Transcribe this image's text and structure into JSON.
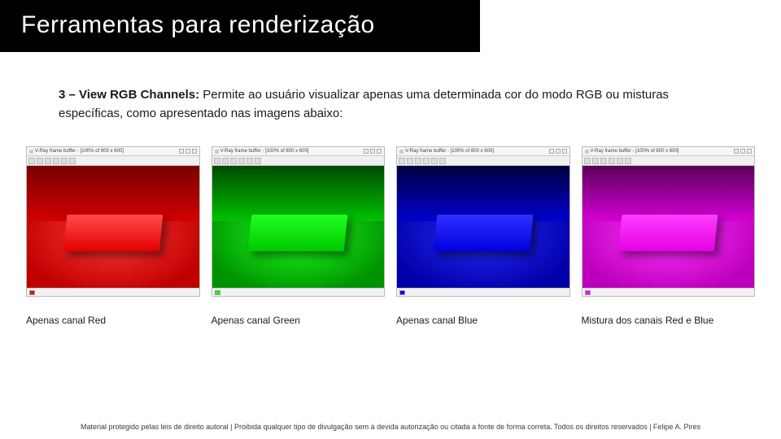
{
  "title": "Ferramentas para renderização",
  "intro": {
    "lead": "3 – View RGB Channels:",
    "rest": " Permite ao usuário visualizar apenas uma determinada cor do modo RGB ou misturas específicas, como apresentado nas imagens abaixo:"
  },
  "vfb_window_title": "V-Ray frame buffer - [100% of 800 x 600]",
  "panels": [
    {
      "key": "red",
      "caption": "Apenas canal Red",
      "swatch": "#ff0000"
    },
    {
      "key": "green",
      "caption": "Apenas canal Green",
      "swatch": "#00ff00"
    },
    {
      "key": "blue",
      "caption": "Apenas canal Blue",
      "swatch": "#0000ff"
    },
    {
      "key": "magenta",
      "caption": "Mistura dos canais Red e Blue",
      "swatch": "#ff00ff"
    }
  ],
  "footer": "Material protegido pelas leis de direito autoral | Proibida qualquer tipo de divulgação sem à devida autorização ou citada a fonte de forma correta. Todos os direitos reservados | Felipe A. Pires"
}
